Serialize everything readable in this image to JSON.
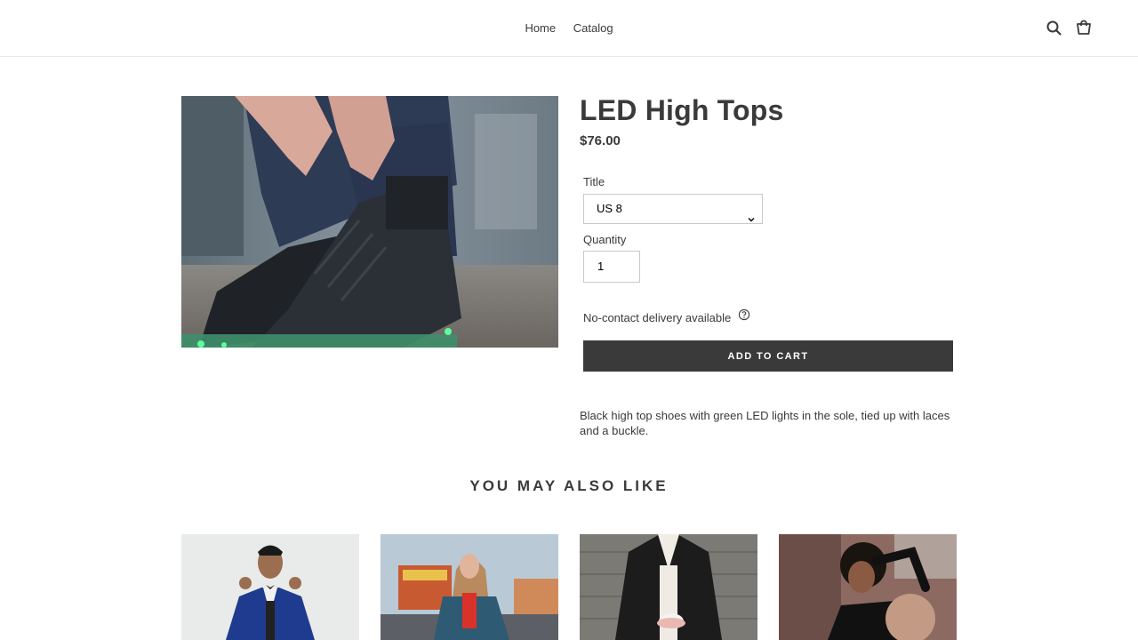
{
  "header": {
    "nav": [
      "Home",
      "Catalog"
    ],
    "icons": [
      "search-icon",
      "cart-icon"
    ]
  },
  "product": {
    "title": "LED High Tops",
    "price": "$76.00",
    "image": "black high top shoes with green LED sole",
    "option_label": "Title",
    "option_value": "US 8",
    "quantity_label": "Quantity",
    "quantity_value": "1",
    "delivery_text": "No-contact delivery available",
    "add_to_cart_label": "Add to cart",
    "description": "Black high top shoes with green LED lights in the sole, tied up with laces and a buckle.",
    "accent_color": "#3a3a3a"
  },
  "related": {
    "heading": "YOU MAY ALSO LIKE",
    "items": [
      {
        "image": "man in blue tuxedo"
      },
      {
        "image": "woman in denim jacket at carnival"
      },
      {
        "image": "woman in leather jacket holding cup"
      },
      {
        "image": "woman with curly hair in black top"
      }
    ]
  }
}
